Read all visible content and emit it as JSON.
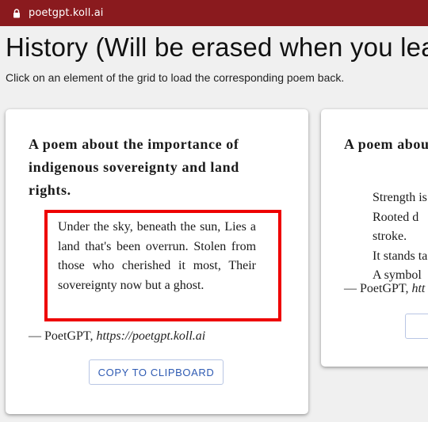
{
  "browser": {
    "url": "poetgpt.koll.ai"
  },
  "page": {
    "title": "History (Will be erased when you leave",
    "subtitle": "Click on an element of the grid to load the corresponding poem back."
  },
  "cards": [
    {
      "title": "A poem about the importance of indigenous sovereignty and land rights.",
      "lines": [
        "Under the sky, beneath the sun,",
        "Lies a land that's been overrun.",
        "Stolen from those who cherished it most,",
        "Their sovereignty now but a ghost."
      ],
      "attribution_prefix": "— PoetGPT, ",
      "attribution_link": "https://poetgpt.koll.ai",
      "copy_label": "COPY TO CLIPBOARD"
    },
    {
      "title": "A poem abou",
      "lines": [
        "Strength is",
        "Rooted d",
        "stroke.",
        "It stands ta",
        "A symbol"
      ],
      "attribution_prefix": "— PoetGPT, ",
      "attribution_link": "htt",
      "copy_label": "CO"
    }
  ],
  "colors": {
    "browser_bar": "#8a1a1e",
    "highlight": "#ee0000",
    "button_text": "#2f5bb3"
  }
}
